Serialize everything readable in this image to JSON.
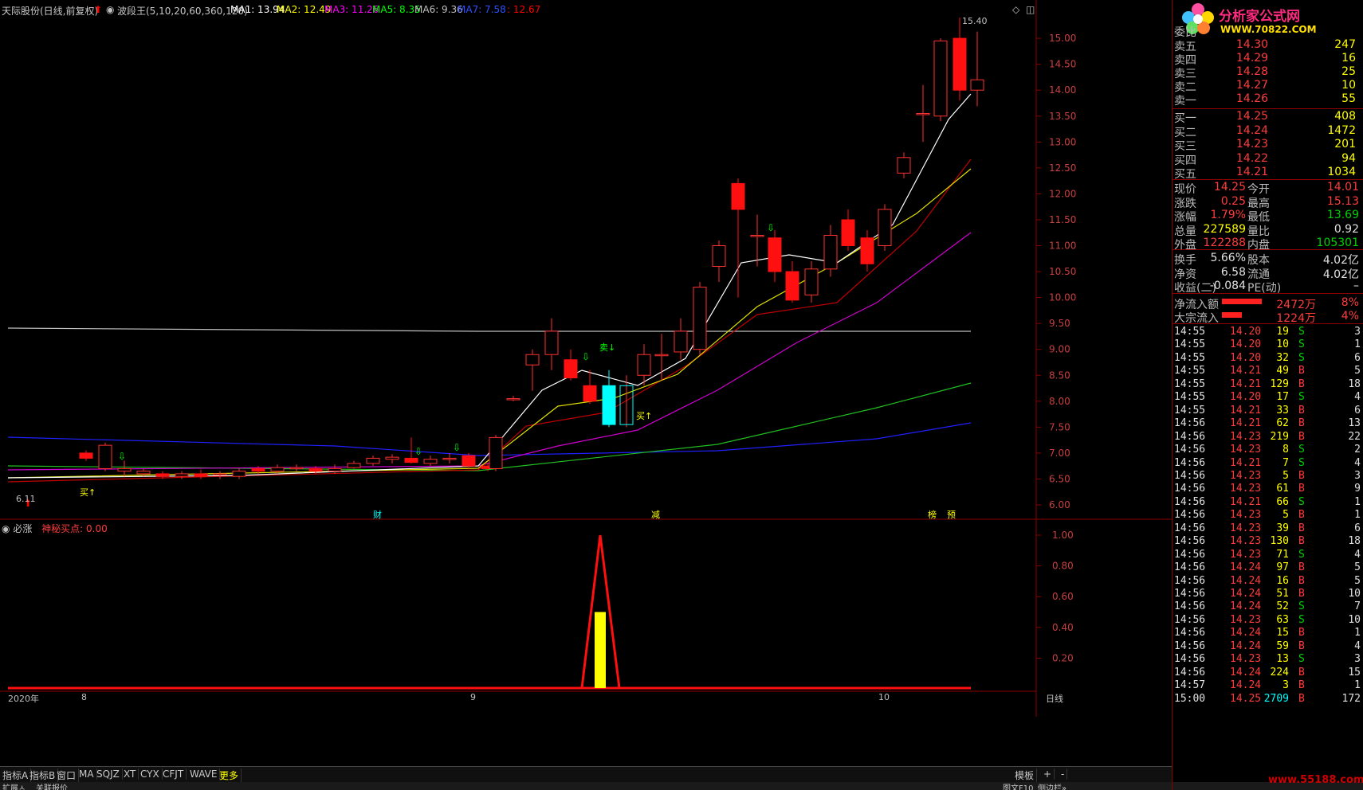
{
  "title": {
    "stock": "天际股份(日线,前复权)",
    "indicator": "波段王(5,10,20,60,360,120)",
    "ma1": "MA1: 13.94",
    "ma2": "MA2: 12.49",
    "ma3": "MA3: 11.26",
    "ma5": "MA5: 8.35",
    "ma6": "MA6: 9.36",
    "ma7": "MA7: 7.58",
    "ma8": ": 12.67",
    "colors": {
      "ma1": "#ffffff",
      "ma2": "#ffff00",
      "ma3": "#ff00ff",
      "ma5": "#00ff00",
      "ma6": "#c0c0c0",
      "ma7": "#0000ff",
      "ma8": "#ff0000"
    }
  },
  "price_axis": [
    "15.00",
    "14.50",
    "14.00",
    "13.50",
    "13.00",
    "12.50",
    "12.00",
    "11.50",
    "11.00",
    "10.50",
    "10.00",
    "9.50",
    "9.00",
    "8.50",
    "8.00",
    "7.50",
    "7.00",
    "6.50",
    "6.00"
  ],
  "osc_axis": [
    "1.00",
    "0.80",
    "0.60",
    "0.40",
    "0.20"
  ],
  "annotations": {
    "high_label": "15.40",
    "low_label": "6.11",
    "buy_labels": [
      "买↑",
      "买↑"
    ],
    "sell_label": "卖↓",
    "events": [
      "财",
      "减",
      "榜",
      "预"
    ]
  },
  "date_axis": {
    "year": "2020年",
    "m8": "8",
    "m9": "9",
    "m10": "10",
    "period": "日线"
  },
  "subchart": {
    "name": "必涨",
    "indicator": "神秘买点: 0.00"
  },
  "toolbar": [
    "指标A",
    "指标B",
    "窗口",
    "MA",
    "SQJZ",
    "XT",
    "CYX",
    "CFJT",
    "WAVE",
    "更多"
  ],
  "toolbar_right": [
    "模板",
    "+",
    "-"
  ],
  "bottom2": [
    "扩展ㅅ",
    "关联报价"
  ],
  "bottom2_right": [
    "图文F10",
    "侧边栏»"
  ],
  "logo": {
    "name": "分析家公式网",
    "url": "WWW.70822.COM"
  },
  "watermark": "www.55188.com",
  "orderbook": {
    "ratio_label": "委比",
    "asks": [
      {
        "label": "卖五",
        "price": "14.30",
        "vol": "247"
      },
      {
        "label": "卖四",
        "price": "14.29",
        "vol": "16"
      },
      {
        "label": "卖三",
        "price": "14.28",
        "vol": "25"
      },
      {
        "label": "卖二",
        "price": "14.27",
        "vol": "10"
      },
      {
        "label": "卖一",
        "price": "14.26",
        "vol": "55"
      }
    ],
    "bids": [
      {
        "label": "买一",
        "price": "14.25",
        "vol": "408"
      },
      {
        "label": "买二",
        "price": "14.24",
        "vol": "1472"
      },
      {
        "label": "买三",
        "price": "14.23",
        "vol": "201"
      },
      {
        "label": "买四",
        "price": "14.22",
        "vol": "94"
      },
      {
        "label": "买五",
        "price": "14.21",
        "vol": "1034"
      }
    ]
  },
  "stats": [
    {
      "l1": "现价",
      "v1": "14.25",
      "l2": "今开",
      "v2": "14.01"
    },
    {
      "l1": "涨跌",
      "v1": "0.25",
      "l2": "最高",
      "v2": "15.13"
    },
    {
      "l1": "涨幅",
      "v1": "1.79%",
      "l2": "最低",
      "v2": "13.69"
    },
    {
      "l1": "总量",
      "v1": "227589",
      "l2": "量比",
      "v2": "0.92"
    },
    {
      "l1": "外盘",
      "v1": "122288",
      "l2": "内盘",
      "v2": "105301"
    }
  ],
  "stats2": [
    {
      "l1": "换手",
      "v1": "5.66%",
      "l2": "股本",
      "v2": "4.02亿"
    },
    {
      "l1": "净资",
      "v1": "6.58",
      "l2": "流通",
      "v2": "4.02亿"
    },
    {
      "l1": "收益(二)",
      "v1": "-0.084",
      "l2": "PE(动)",
      "v2": "–"
    }
  ],
  "flows": [
    {
      "label": "净流入额",
      "value": "2472万",
      "pct": "8%",
      "fill": 0.8
    },
    {
      "label": "大宗流入",
      "value": "1224万",
      "pct": "4%",
      "fill": 0.4
    }
  ],
  "trades": [
    {
      "t": "14:55",
      "p": "14.20",
      "v": "19",
      "s": "S",
      "n": "3"
    },
    {
      "t": "14:55",
      "p": "14.20",
      "v": "10",
      "s": "S",
      "n": "1"
    },
    {
      "t": "14:55",
      "p": "14.20",
      "v": "32",
      "s": "S",
      "n": "6"
    },
    {
      "t": "14:55",
      "p": "14.21",
      "v": "49",
      "s": "B",
      "n": "5"
    },
    {
      "t": "14:55",
      "p": "14.21",
      "v": "129",
      "s": "B",
      "n": "18"
    },
    {
      "t": "14:55",
      "p": "14.20",
      "v": "17",
      "s": "S",
      "n": "4"
    },
    {
      "t": "14:55",
      "p": "14.21",
      "v": "33",
      "s": "B",
      "n": "6"
    },
    {
      "t": "14:56",
      "p": "14.21",
      "v": "62",
      "s": "B",
      "n": "13"
    },
    {
      "t": "14:56",
      "p": "14.23",
      "v": "219",
      "s": "B",
      "n": "22"
    },
    {
      "t": "14:56",
      "p": "14.23",
      "v": "8",
      "s": "S",
      "n": "2"
    },
    {
      "t": "14:56",
      "p": "14.21",
      "v": "7",
      "s": "S",
      "n": "4"
    },
    {
      "t": "14:56",
      "p": "14.23",
      "v": "5",
      "s": "B",
      "n": "3"
    },
    {
      "t": "14:56",
      "p": "14.23",
      "v": "61",
      "s": "B",
      "n": "9"
    },
    {
      "t": "14:56",
      "p": "14.21",
      "v": "66",
      "s": "S",
      "n": "1"
    },
    {
      "t": "14:56",
      "p": "14.23",
      "v": "5",
      "s": "B",
      "n": "1"
    },
    {
      "t": "14:56",
      "p": "14.23",
      "v": "39",
      "s": "B",
      "n": "6"
    },
    {
      "t": "14:56",
      "p": "14.23",
      "v": "130",
      "s": "B",
      "n": "18"
    },
    {
      "t": "14:56",
      "p": "14.23",
      "v": "71",
      "s": "S",
      "n": "4"
    },
    {
      "t": "14:56",
      "p": "14.24",
      "v": "97",
      "s": "B",
      "n": "5"
    },
    {
      "t": "14:56",
      "p": "14.24",
      "v": "16",
      "s": "B",
      "n": "5"
    },
    {
      "t": "14:56",
      "p": "14.24",
      "v": "51",
      "s": "B",
      "n": "10"
    },
    {
      "t": "14:56",
      "p": "14.24",
      "v": "52",
      "s": "S",
      "n": "7"
    },
    {
      "t": "14:56",
      "p": "14.23",
      "v": "63",
      "s": "S",
      "n": "10"
    },
    {
      "t": "14:56",
      "p": "14.24",
      "v": "15",
      "s": "B",
      "n": "1"
    },
    {
      "t": "14:56",
      "p": "14.24",
      "v": "59",
      "s": "B",
      "n": "4"
    },
    {
      "t": "14:56",
      "p": "14.23",
      "v": "13",
      "s": "S",
      "n": "3"
    },
    {
      "t": "14:56",
      "p": "14.24",
      "v": "224",
      "s": "B",
      "n": "15"
    },
    {
      "t": "14:57",
      "p": "14.24",
      "v": "3",
      "s": "B",
      "n": "1"
    },
    {
      "t": "15:00",
      "p": "14.25",
      "v": "2709",
      "s": "B",
      "n": "172"
    }
  ]
}
